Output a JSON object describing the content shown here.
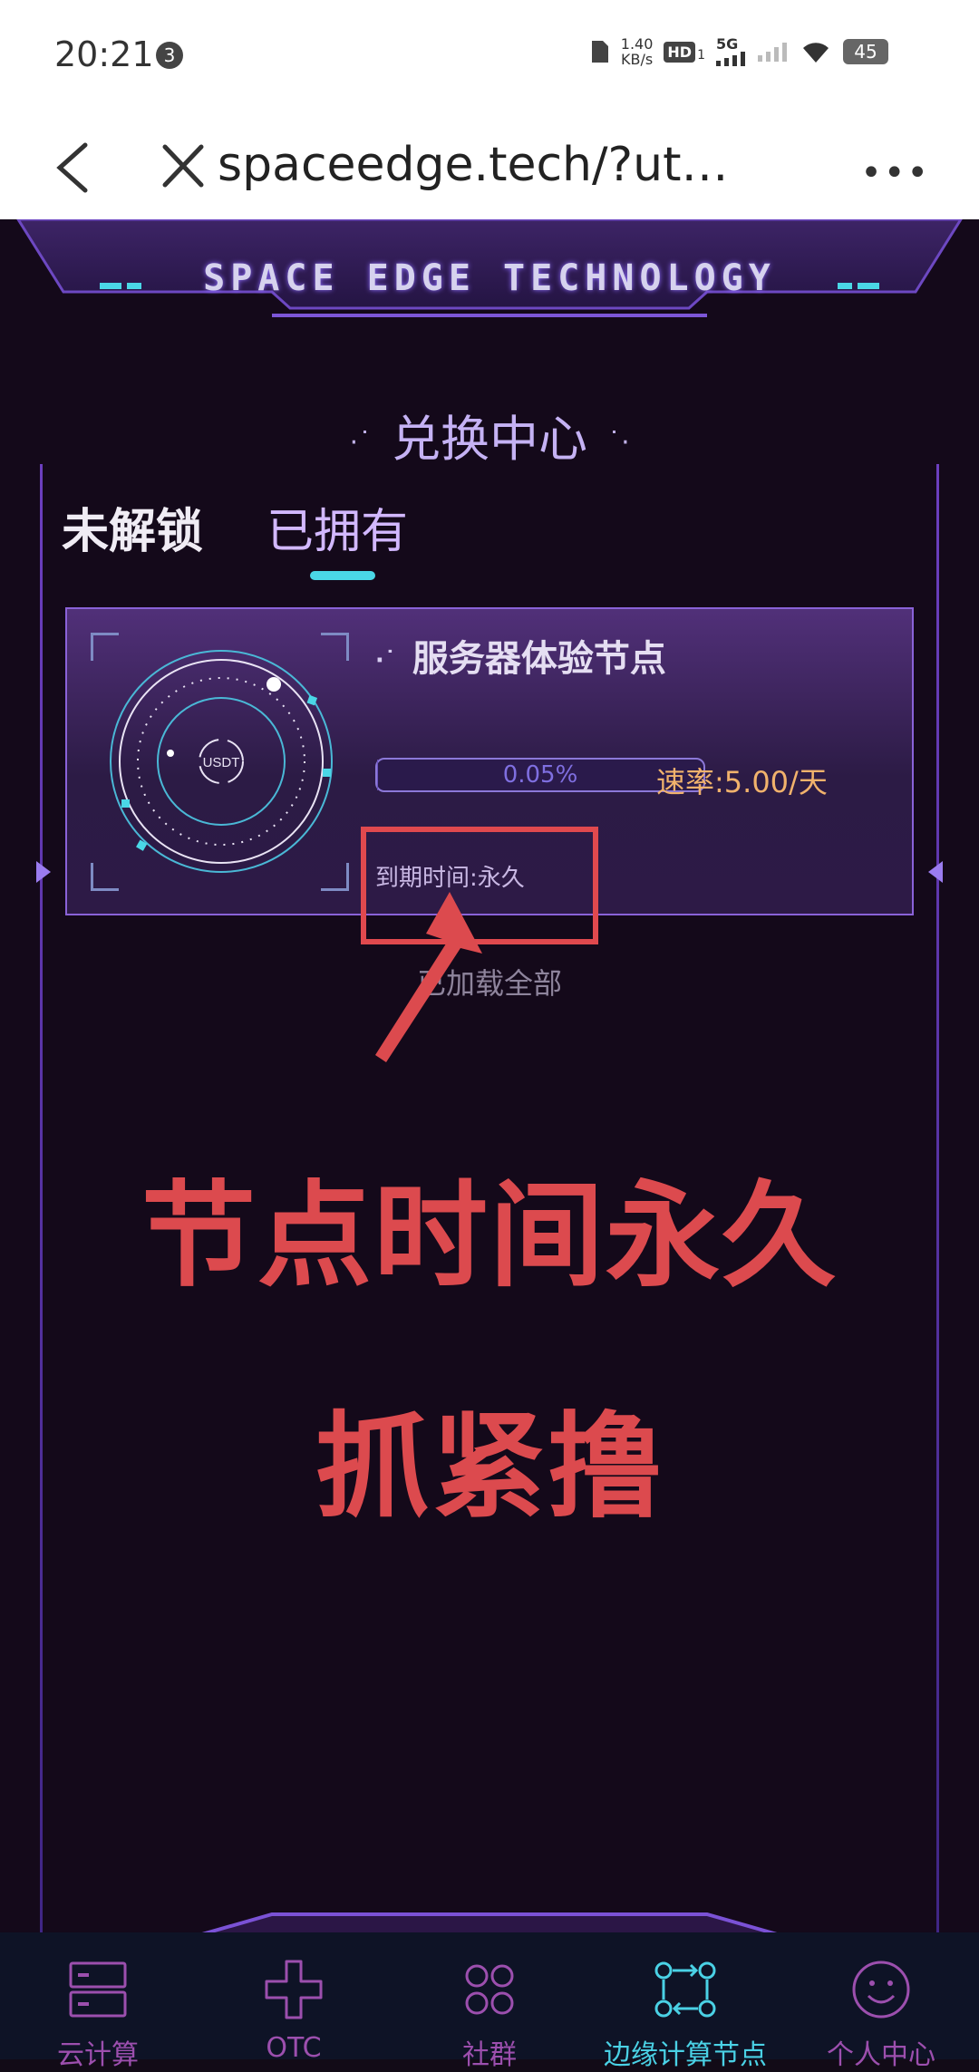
{
  "status_bar": {
    "time": "20:21",
    "notification_count": "3",
    "net_speed_value": "1.40",
    "net_speed_unit": "KB/s",
    "hd_label": "HD",
    "hd_sub": "1",
    "network_label": "5G",
    "battery": "45"
  },
  "browser": {
    "url": "spaceedge.tech/?ut…",
    "more_label": "•••"
  },
  "app": {
    "banner_text": "SPACE EDGE TECHNOLOGY",
    "section_title": "兑换中心",
    "tabs": [
      {
        "label": "未解锁",
        "active": false
      },
      {
        "label": "已拥有",
        "active": true
      }
    ],
    "node_card": {
      "title": "服务器体验节点",
      "coin_label": "USDT",
      "progress_text": "0.05%",
      "progress_value": 0.05,
      "rate_text": "速率:5.00/天",
      "expire_text": "到期时间:永久"
    },
    "loaded_all_text": "已加载全部",
    "accent_color": "#4ad7e6"
  },
  "overlay": {
    "headline_1": "节点时间永久",
    "headline_2": "抓紧撸",
    "annotation_color": "#dc4a4e"
  },
  "tabbar": {
    "items": [
      {
        "label": "云计算",
        "icon": "server-icon",
        "active": false
      },
      {
        "label": "OTC",
        "icon": "otc-icon",
        "active": false
      },
      {
        "label": "社群",
        "icon": "community-icon",
        "active": false
      },
      {
        "label": "边缘计算节点",
        "icon": "edge-node-icon",
        "active": true
      },
      {
        "label": "个人中心",
        "icon": "smiley-icon",
        "active": false
      }
    ]
  }
}
